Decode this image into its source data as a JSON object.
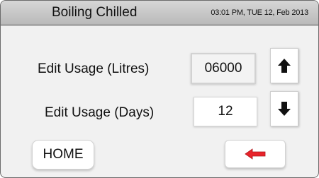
{
  "header": {
    "title": "Boiling Chilled",
    "datetime": "03:01 PM, TUE 12, Feb 2013"
  },
  "usage_litres": {
    "label": "Edit Usage (Litres)",
    "value": "06000",
    "up_icon": "arrow-up-icon"
  },
  "usage_days": {
    "label": "Edit Usage (Days)",
    "value": "12",
    "down_icon": "arrow-down-icon"
  },
  "footer": {
    "home_label": "HOME",
    "back_icon": "arrow-left-icon",
    "back_icon_color": "#e8232a"
  }
}
